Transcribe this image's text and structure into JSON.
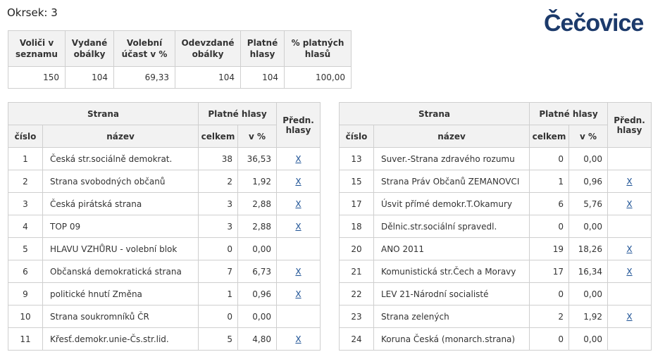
{
  "header": {
    "okrsek_label": "Okrsek: 3",
    "town": "Čečovice"
  },
  "summary": {
    "headers": [
      "Voliči v seznamu",
      "Vydané obálky",
      "Volební účast v %",
      "Odevzdané obálky",
      "Platné hlasy",
      "% platných hlasů"
    ],
    "values": [
      "150",
      "104",
      "69,33",
      "104",
      "104",
      "100,00"
    ]
  },
  "party_headers": {
    "strana": "Strana",
    "platne": "Platné hlasy",
    "predn": "Předn. hlasy",
    "cislo": "číslo",
    "nazev": "název",
    "celkem": "celkem",
    "pct": "v %"
  },
  "left_rows": [
    {
      "num": "1",
      "name": "Česká str.sociálně demokrat.",
      "total": "38",
      "pct": "36,53",
      "x": "X"
    },
    {
      "num": "2",
      "name": "Strana svobodných občanů",
      "total": "2",
      "pct": "1,92",
      "x": "X"
    },
    {
      "num": "3",
      "name": "Česká pirátská strana",
      "total": "3",
      "pct": "2,88",
      "x": "X"
    },
    {
      "num": "4",
      "name": "TOP 09",
      "total": "3",
      "pct": "2,88",
      "x": "X"
    },
    {
      "num": "5",
      "name": "HLAVU VZHŮRU - volební blok",
      "total": "0",
      "pct": "0,00",
      "x": ""
    },
    {
      "num": "6",
      "name": "Občanská demokratická strana",
      "total": "7",
      "pct": "6,73",
      "x": "X"
    },
    {
      "num": "9",
      "name": "politické hnutí Změna",
      "total": "1",
      "pct": "0,96",
      "x": "X"
    },
    {
      "num": "10",
      "name": "Strana soukromníků ČR",
      "total": "0",
      "pct": "0,00",
      "x": ""
    },
    {
      "num": "11",
      "name": "Křesť.demokr.unie-Čs.str.lid.",
      "total": "5",
      "pct": "4,80",
      "x": "X"
    }
  ],
  "right_rows": [
    {
      "num": "13",
      "name": "Suver.-Strana zdravého rozumu",
      "total": "0",
      "pct": "0,00",
      "x": ""
    },
    {
      "num": "15",
      "name": "Strana Práv Občanů ZEMANOVCI",
      "total": "1",
      "pct": "0,96",
      "x": "X"
    },
    {
      "num": "17",
      "name": "Úsvit přímé demokr.T.Okamury",
      "total": "6",
      "pct": "5,76",
      "x": "X"
    },
    {
      "num": "18",
      "name": "Dělnic.str.sociální spravedl.",
      "total": "0",
      "pct": "0,00",
      "x": ""
    },
    {
      "num": "20",
      "name": "ANO 2011",
      "total": "19",
      "pct": "18,26",
      "x": "X"
    },
    {
      "num": "21",
      "name": "Komunistická str.Čech a Moravy",
      "total": "17",
      "pct": "16,34",
      "x": "X"
    },
    {
      "num": "22",
      "name": "LEV 21-Národní socialisté",
      "total": "0",
      "pct": "0,00",
      "x": ""
    },
    {
      "num": "23",
      "name": "Strana zelených",
      "total": "2",
      "pct": "1,92",
      "x": "X"
    },
    {
      "num": "24",
      "name": "Koruna Česká (monarch.strana)",
      "total": "0",
      "pct": "0,00",
      "x": ""
    }
  ]
}
